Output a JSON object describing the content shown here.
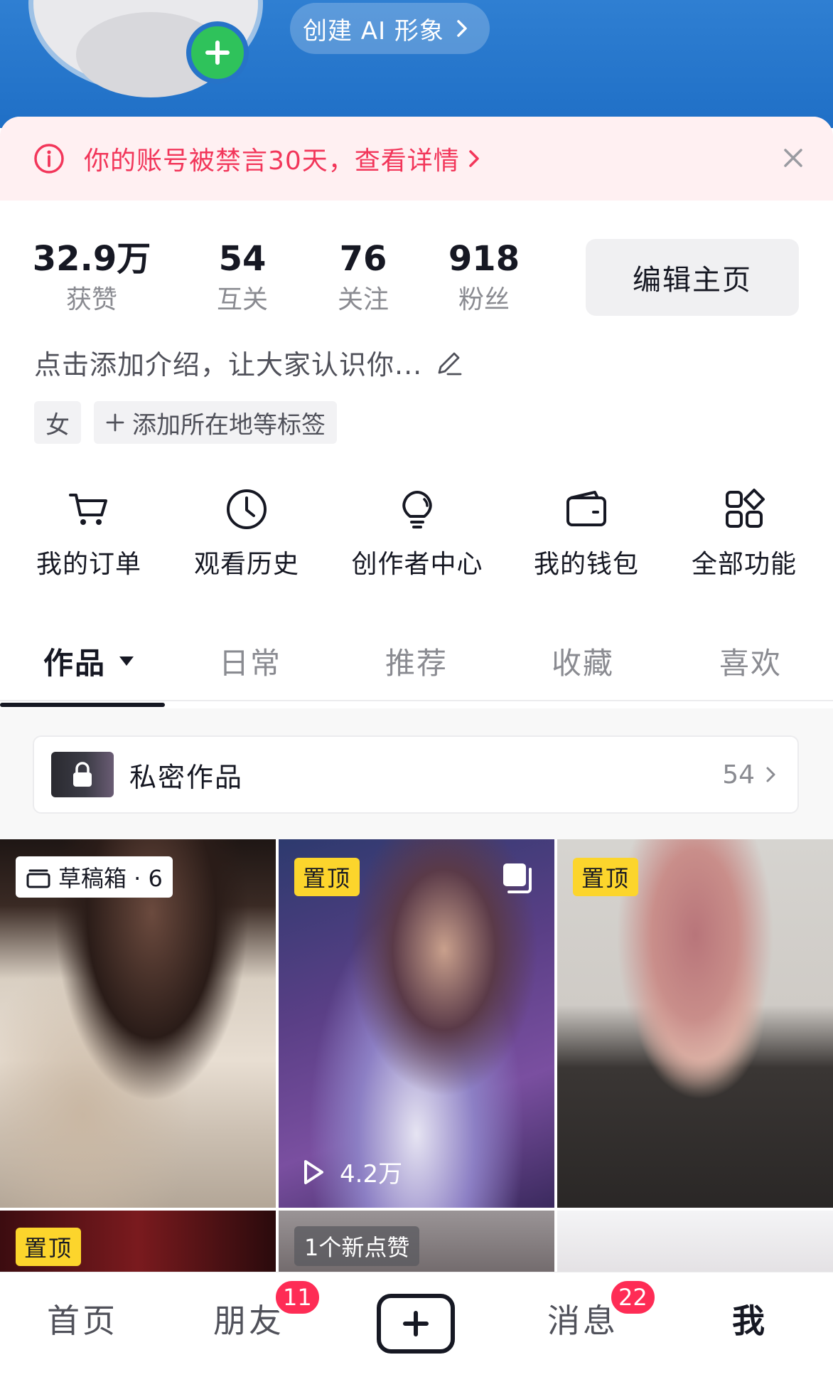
{
  "header": {
    "ai_button_label": "创建 AI 形象",
    "accent_color": "#2a79cf"
  },
  "notice": {
    "text": "你的账号被禁言30天，查看详情",
    "color": "#f2365a"
  },
  "stats": [
    {
      "value": "32.9万",
      "label": "获赞"
    },
    {
      "value": "54",
      "label": "互关"
    },
    {
      "value": "76",
      "label": "关注"
    },
    {
      "value": "918",
      "label": "粉丝"
    }
  ],
  "edit_profile_label": "编辑主页",
  "bio": {
    "placeholder": "点击添加介绍，让大家认识你..."
  },
  "tags": [
    {
      "label": "女"
    },
    {
      "label": "添加所在地等标签"
    }
  ],
  "features": [
    {
      "label": "我的订单",
      "icon": "cart-icon"
    },
    {
      "label": "观看历史",
      "icon": "clock-icon"
    },
    {
      "label": "创作者中心",
      "icon": "lightbulb-icon"
    },
    {
      "label": "我的钱包",
      "icon": "wallet-icon"
    },
    {
      "label": "全部功能",
      "icon": "grid-icon"
    }
  ],
  "tabs": [
    {
      "label": "作品",
      "active": true
    },
    {
      "label": "日常",
      "active": false
    },
    {
      "label": "推荐",
      "active": false
    },
    {
      "label": "收藏",
      "active": false
    },
    {
      "label": "喜欢",
      "active": false
    }
  ],
  "private_works": {
    "label": "私密作品",
    "count": "54"
  },
  "grid": {
    "draft_label": "草稿箱 · 6",
    "pinned_label": "置顶",
    "plays": "4.2万",
    "new_like": "1个新点赞"
  },
  "bottom_nav": {
    "home": "首页",
    "friends": "朋友",
    "friends_badge": "11",
    "messages": "消息",
    "messages_badge": "22",
    "me": "我"
  }
}
